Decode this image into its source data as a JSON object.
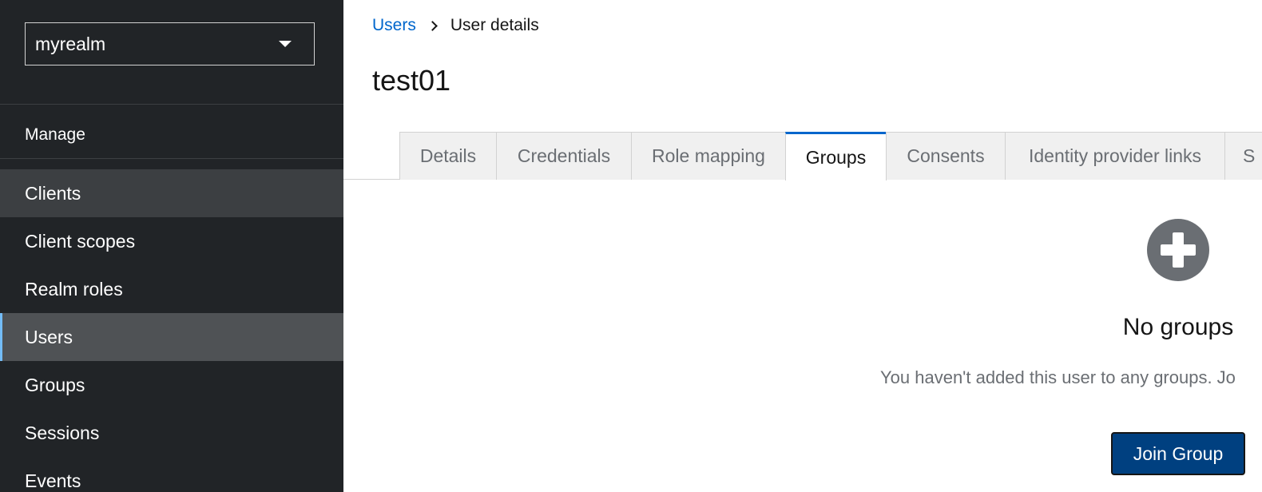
{
  "realm_selector": {
    "value": "myrealm"
  },
  "sidebar": {
    "section_label": "Manage",
    "items": [
      {
        "label": "Clients"
      },
      {
        "label": "Client scopes"
      },
      {
        "label": "Realm roles"
      },
      {
        "label": "Users"
      },
      {
        "label": "Groups"
      },
      {
        "label": "Sessions"
      },
      {
        "label": "Events"
      }
    ]
  },
  "breadcrumb": {
    "parent": "Users",
    "current": "User details"
  },
  "page_title": "test01",
  "tabs": [
    {
      "label": "Details"
    },
    {
      "label": "Credentials"
    },
    {
      "label": "Role mapping"
    },
    {
      "label": "Groups"
    },
    {
      "label": "Consents"
    },
    {
      "label": "Identity provider links"
    },
    {
      "label": "S"
    }
  ],
  "active_tab": "Groups",
  "empty_state": {
    "icon": "plus-circle-icon",
    "title": "No groups",
    "body": "You haven't added this user to any groups. Jo",
    "button_label": "Join Group"
  },
  "colors": {
    "sidebar_bg": "#212427",
    "link": "#0066cc",
    "primary_button": "#004080"
  }
}
